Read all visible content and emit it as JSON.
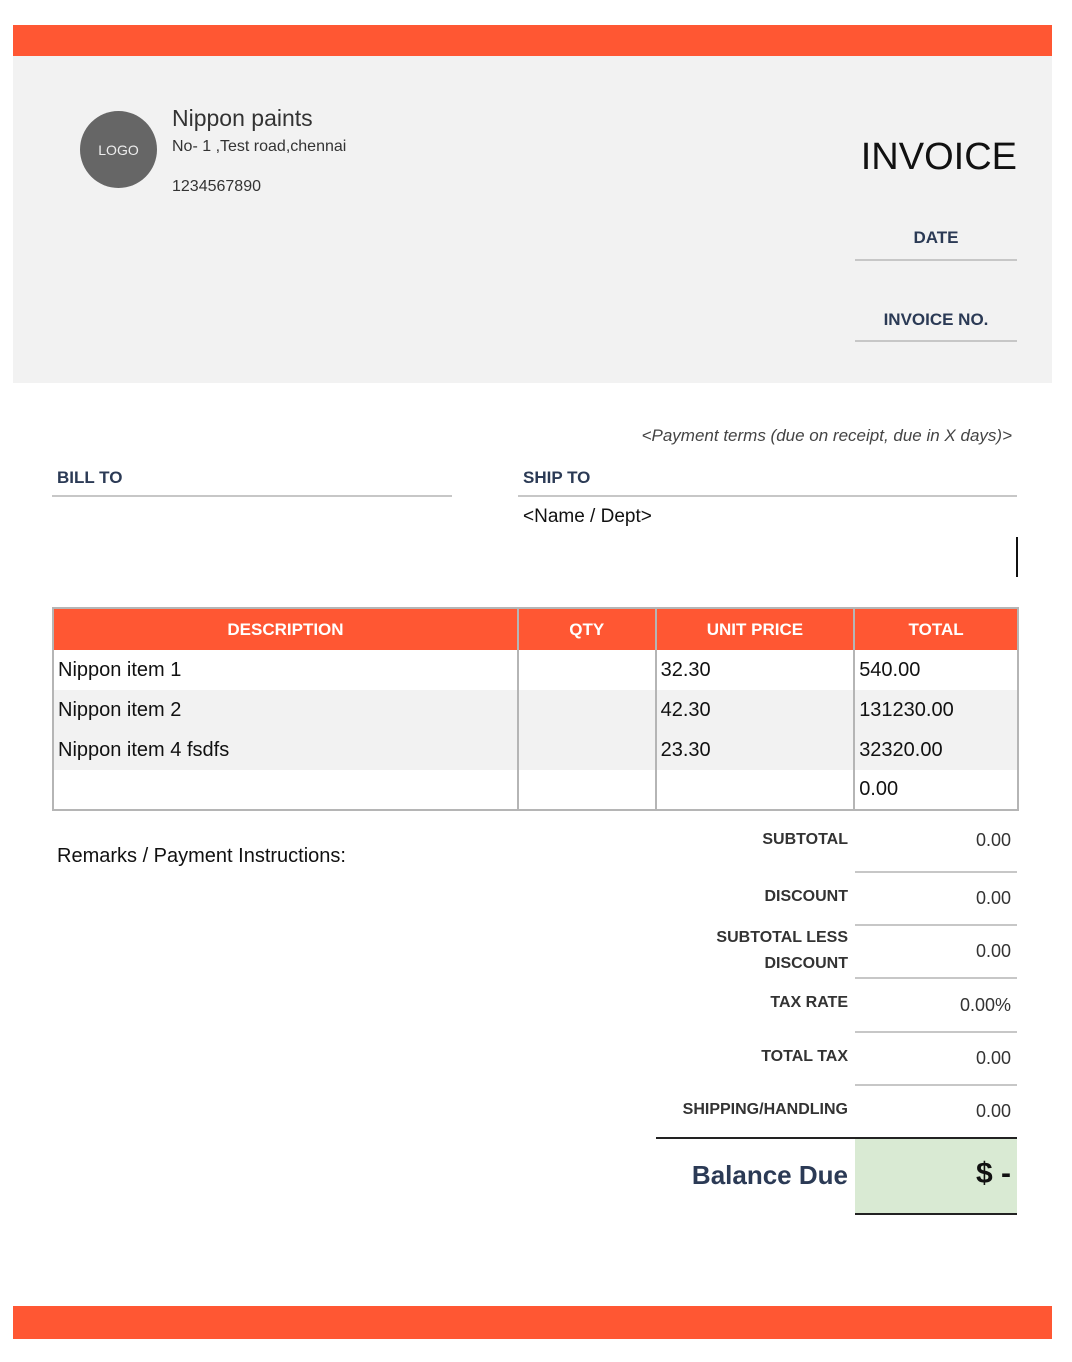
{
  "company": {
    "logo_text": "LOGO",
    "name": "Nippon paints",
    "address": "No- 1 ,Test road,chennai",
    "phone": "1234567890"
  },
  "invoice": {
    "title": "INVOICE",
    "date_label": "DATE",
    "invoice_no_label": "INVOICE NO.",
    "payment_terms": "<Payment terms (due on receipt, due in X days)>"
  },
  "parties": {
    "bill_to_label": "BILL TO",
    "ship_to_label": "SHIP TO",
    "ship_to_name": "<Name / Dept>"
  },
  "table": {
    "headers": [
      "DESCRIPTION",
      "QTY",
      "UNIT PRICE",
      "TOTAL"
    ],
    "rows": [
      {
        "description": "Nippon item 1",
        "qty": "",
        "unit_price": "32.30",
        "total": "540.00"
      },
      {
        "description": "Nippon item 2",
        "qty": "",
        "unit_price": "42.30",
        "total": "131230.00"
      },
      {
        "description": "Nippon item 4 fsdfs",
        "qty": "",
        "unit_price": "23.30",
        "total": "32320.00"
      },
      {
        "description": "",
        "qty": "",
        "unit_price": "",
        "total": "0.00"
      }
    ]
  },
  "remarks_label": "Remarks / Payment Instructions:",
  "summary": {
    "subtotal_label": "SUBTOTAL",
    "subtotal_value": "0.00",
    "discount_label": "DISCOUNT",
    "discount_value": "0.00",
    "subtotal_less_discount_label_1": "SUBTOTAL LESS",
    "subtotal_less_discount_label_2": "DISCOUNT",
    "subtotal_less_discount_value": "0.00",
    "tax_rate_label": "TAX RATE",
    "tax_rate_value": "0.00%",
    "total_tax_label": "TOTAL TAX",
    "total_tax_value": "0.00",
    "shipping_label": "SHIPPING/HANDLING",
    "shipping_value": "0.00",
    "balance_due_label": "Balance Due",
    "balance_due_value": "$ -"
  },
  "colors": {
    "accent": "#ff5733",
    "header_panel": "#f2f2f2",
    "label_navy": "#2b3a55",
    "balance_fill": "#d9ead3"
  }
}
